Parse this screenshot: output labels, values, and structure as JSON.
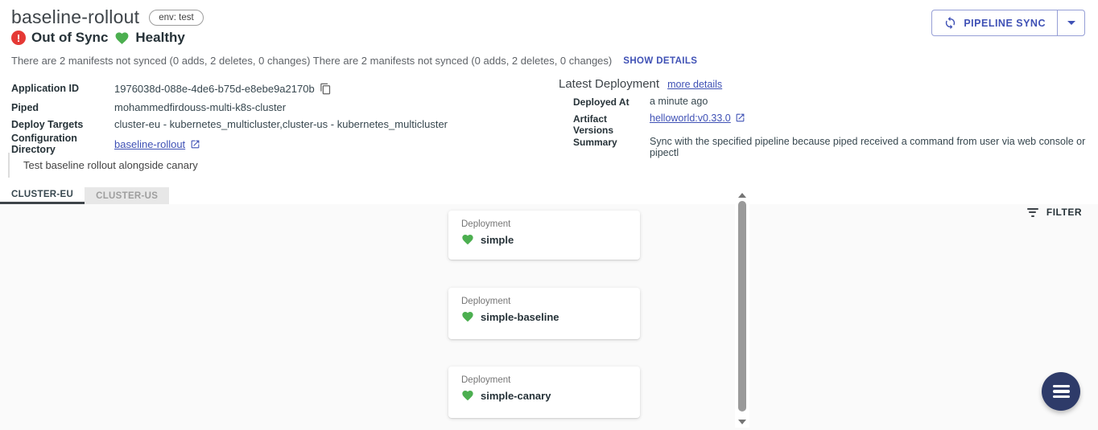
{
  "header": {
    "app_name": "baseline-rollout",
    "env_chip": "env: test",
    "sync_status": "Out of Sync",
    "health_status": "Healthy",
    "sync_reason": "There are 2 manifests not synced (0 adds, 2 deletes, 0 changes) There are 2 manifests not synced (0 adds, 2 deletes, 0 changes)",
    "show_details_label": "SHOW DETAILS",
    "pipeline_sync_label": "PIPELINE SYNC"
  },
  "details": {
    "left": [
      {
        "label": "Application ID",
        "value": "1976038d-088e-4de6-b75d-e8ebe9a2170b"
      },
      {
        "label": "Piped",
        "value": "mohammedfirdouss-multi-k8s-cluster"
      },
      {
        "label": "Deploy Targets",
        "value": "cluster-eu - kubernetes_multicluster,cluster-us - kubernetes_multicluster"
      },
      {
        "label": "Configuration Directory",
        "value": "baseline-rollout"
      }
    ],
    "latest_deployment": {
      "title": "Latest Deployment",
      "more_details_label": "more details",
      "rows": [
        {
          "label": "Deployed At",
          "value": "a minute ago"
        },
        {
          "label": "Artifact Versions",
          "value": "helloworld:v0.33.0"
        },
        {
          "label": "Summary",
          "value": "Sync with the specified pipeline because piped received a command from user via web console or pipectl"
        }
      ]
    },
    "description": "Test baseline rollout alongside canary"
  },
  "tabs": [
    {
      "label": "CLUSTER-EU",
      "active": true
    },
    {
      "label": "CLUSTER-US",
      "active": false
    }
  ],
  "canvas": {
    "filter_label": "FILTER",
    "cards": [
      {
        "kind": "Deployment",
        "name": "simple",
        "health": "healthy"
      },
      {
        "kind": "Deployment",
        "name": "simple-baseline",
        "health": "healthy"
      },
      {
        "kind": "Deployment",
        "name": "simple-canary",
        "health": "healthy"
      }
    ]
  },
  "colors": {
    "primary_indigo": "#3f51b5",
    "error_red": "#e53935",
    "healthy_green": "#4caf50",
    "fab_navy": "#2e3b69",
    "canvas_bg": "#fafafa"
  }
}
